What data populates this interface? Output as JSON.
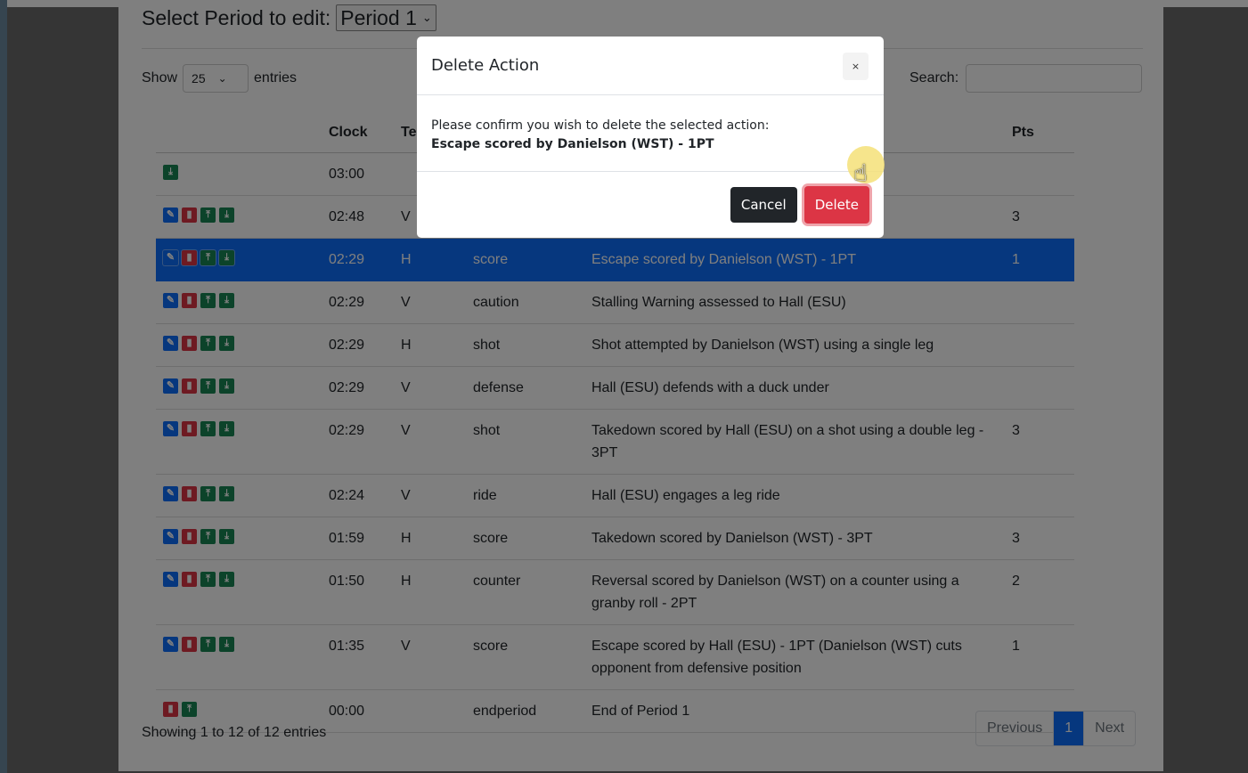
{
  "period": {
    "label": "Select Period to edit:",
    "selected": "Period 1"
  },
  "length": {
    "prefix": "Show",
    "value": "25",
    "suffix": "entries"
  },
  "search": {
    "label": "Search:",
    "value": ""
  },
  "table": {
    "headers": [
      "",
      "Clock",
      "Team",
      "Type",
      "Description",
      "Pts"
    ],
    "rows": [
      {
        "icons": [
          "down"
        ],
        "clock": "03:00",
        "team": "",
        "type": "",
        "desc": "",
        "pts": ""
      },
      {
        "icons": [
          "edit",
          "del",
          "up",
          "down"
        ],
        "clock": "02:48",
        "team": "V",
        "type": "",
        "desc": "",
        "pts": "3"
      },
      {
        "icons": [
          "edit",
          "del",
          "up",
          "down"
        ],
        "clock": "02:29",
        "team": "H",
        "type": "score",
        "desc": "Escape scored by Danielson (WST) - 1PT",
        "pts": "1"
      },
      {
        "icons": [
          "edit",
          "del",
          "up",
          "down"
        ],
        "clock": "02:29",
        "team": "V",
        "type": "caution",
        "desc": "Stalling Warning assessed to Hall (ESU)",
        "pts": ""
      },
      {
        "icons": [
          "edit",
          "del",
          "up",
          "down"
        ],
        "clock": "02:29",
        "team": "H",
        "type": "shot",
        "desc": "Shot attempted by Danielson (WST) using a single leg",
        "pts": ""
      },
      {
        "icons": [
          "edit",
          "del",
          "up",
          "down"
        ],
        "clock": "02:29",
        "team": "V",
        "type": "defense",
        "desc": "Hall (ESU) defends with a duck under",
        "pts": ""
      },
      {
        "icons": [
          "edit",
          "del",
          "up",
          "down"
        ],
        "clock": "02:29",
        "team": "V",
        "type": "shot",
        "desc": "Takedown scored by Hall (ESU) on a shot using a double leg - 3PT",
        "pts": "3"
      },
      {
        "icons": [
          "edit",
          "del",
          "up",
          "down"
        ],
        "clock": "02:24",
        "team": "V",
        "type": "ride",
        "desc": "Hall (ESU) engages a leg ride",
        "pts": ""
      },
      {
        "icons": [
          "edit",
          "del",
          "up",
          "down"
        ],
        "clock": "01:59",
        "team": "H",
        "type": "score",
        "desc": "Takedown scored by Danielson (WST) - 3PT",
        "pts": "3"
      },
      {
        "icons": [
          "edit",
          "del",
          "up",
          "down"
        ],
        "clock": "01:50",
        "team": "H",
        "type": "counter",
        "desc": "Reversal scored by Danielson (WST) on a counter using a granby roll - 2PT",
        "pts": "2"
      },
      {
        "icons": [
          "edit",
          "del",
          "up",
          "down"
        ],
        "clock": "01:35",
        "team": "V",
        "type": "score",
        "desc": "Escape scored by Hall (ESU) - 1PT (Danielson (WST) cuts opponent from defensive position",
        "pts": "1"
      },
      {
        "icons": [
          "del",
          "up"
        ],
        "clock": "00:00",
        "team": "",
        "type": "endperiod",
        "desc": "End of Period 1",
        "pts": ""
      }
    ],
    "selected_index": 2
  },
  "footer": {
    "info": "Showing 1 to 12 of 12 entries",
    "prev": "Previous",
    "page": "1",
    "next": "Next"
  },
  "modal": {
    "title": "Delete Action",
    "close": "×",
    "message": "Please confirm you wish to delete the selected action:",
    "item": "Escape scored by Danielson (WST) - 1PT",
    "cancel": "Cancel",
    "delete": "Delete"
  },
  "colors": {
    "edit": "#0d6efd",
    "delete": "#dc3545",
    "move": "#198754",
    "selected_row": "#0d6efd"
  },
  "icon_names": {
    "edit": "edit-icon",
    "del": "trash-icon",
    "up": "move-up-icon",
    "down": "move-down-icon",
    "close": "close-icon",
    "cursor": "hand-pointer-icon"
  }
}
